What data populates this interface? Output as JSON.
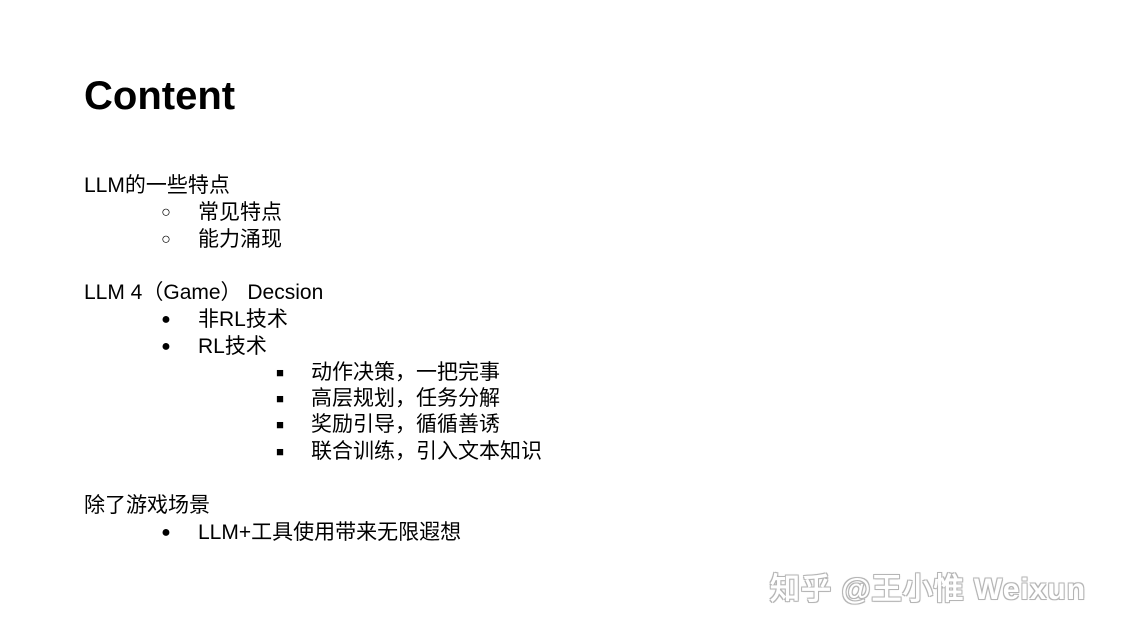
{
  "title": "Content",
  "section1": {
    "heading": "LLM的一些特点",
    "items": [
      "常见特点",
      "能力涌现"
    ]
  },
  "section2": {
    "heading": "LLM 4（Game） Decsion",
    "items": [
      "非RL技术",
      "RL技术"
    ],
    "subitems": [
      "动作决策，一把完事",
      "高层规划，任务分解",
      "奖励引导，循循善诱",
      "联合训练，引入文本知识"
    ]
  },
  "section3": {
    "heading": "除了游戏场景",
    "items": [
      "LLM+工具使用带来无限遐想"
    ]
  },
  "bullets": {
    "hollow": "○",
    "filled": "●",
    "square": "■"
  },
  "watermark": "知乎 @王小惟 Weixun"
}
